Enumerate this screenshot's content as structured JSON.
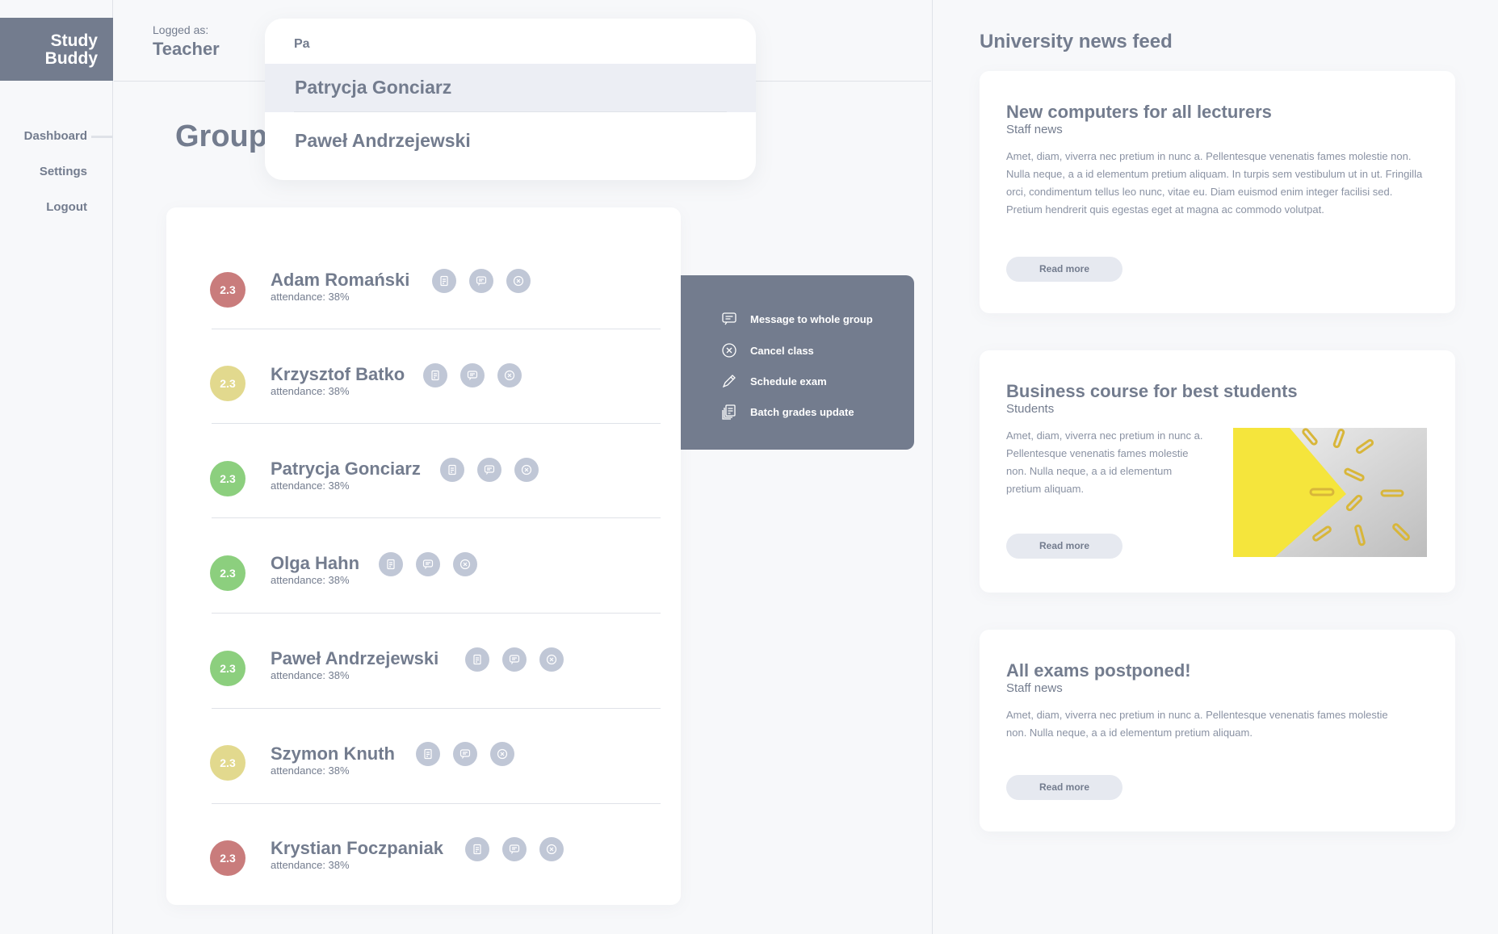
{
  "app": {
    "logo": "Study Buddy"
  },
  "sidebar": {
    "items": [
      {
        "label": "Dashboard",
        "active": true
      },
      {
        "label": "Settings"
      },
      {
        "label": "Logout"
      }
    ]
  },
  "header": {
    "logged_as_label": "Logged as:",
    "role": "Teacher"
  },
  "page": {
    "title": "Group"
  },
  "search": {
    "value": "Pa",
    "results": [
      "Patrycja Gonciarz",
      "Paweł Andrzejewski"
    ]
  },
  "students": [
    {
      "average": "2.3",
      "name": "Adam Romański",
      "attendance": "attendance: 38%",
      "color": "#c97c7c"
    },
    {
      "average": "2.3",
      "name": "Krzysztof Batko",
      "attendance": "attendance: 38%",
      "color": "#e2d98e"
    },
    {
      "average": "2.3",
      "name": "Patrycja Gonciarz",
      "attendance": "attendance: 38%",
      "color": "#8ccf7e"
    },
    {
      "average": "2.3",
      "name": "Olga Hahn",
      "attendance": "attendance: 38%",
      "color": "#8ccf7e"
    },
    {
      "average": "2.3",
      "name": "Paweł Andrzejewski",
      "attendance": "attendance: 38%",
      "color": "#8ccf7e"
    },
    {
      "average": "2.3",
      "name": "Szymon Knuth",
      "attendance": "attendance: 38%",
      "color": "#e2d98e"
    },
    {
      "average": "2.3",
      "name": "Krystian Foczpaniak",
      "attendance": "attendance: 38%",
      "color": "#c97c7c"
    }
  ],
  "student_action_icons": [
    "grades-icon",
    "message-icon",
    "remove-icon"
  ],
  "group_actions": [
    {
      "label": "Message to whole group",
      "icon": "message-icon"
    },
    {
      "label": "Cancel class",
      "icon": "cancel-icon"
    },
    {
      "label": "Schedule exam",
      "icon": "pencil-icon"
    },
    {
      "label": "Batch grades update",
      "icon": "grades-stack-icon"
    }
  ],
  "news": {
    "title": "University news feed",
    "read_more_label": "Read more",
    "items": [
      {
        "title": "New computers for all lecturers",
        "category": "Staff news",
        "content": "Amet, diam, viverra nec pretium in nunc a. Pellentesque venenatis fames molestie non. Nulla neque, a a id elementum pretium aliquam. In turpis sem vestibulum ut in ut. Fringilla orci, condimentum tellus leo nunc, vitae eu. Diam euismod enim integer facilisi sed. Pretium hendrerit quis egestas eget at magna ac commodo volutpat."
      },
      {
        "title": "Business course for best students",
        "category": "Students",
        "content": "Amet, diam, viverra nec pretium in nunc a. Pellentesque venenatis fames molestie non. Nulla neque, a a id elementum pretium aliquam."
      },
      {
        "title": "All exams postponed!",
        "category": "Staff news",
        "content": "Amet, diam, viverra nec pretium in nunc a. Pellentesque venenatis fames molestie non. Nulla neque, a a id elementum pretium aliquam."
      }
    ]
  },
  "colors": {
    "primary": "#737c8e",
    "background": "#f7f8fa",
    "success": "#8ccf7e",
    "warning": "#e2d98e",
    "error": "#c97c7c"
  }
}
